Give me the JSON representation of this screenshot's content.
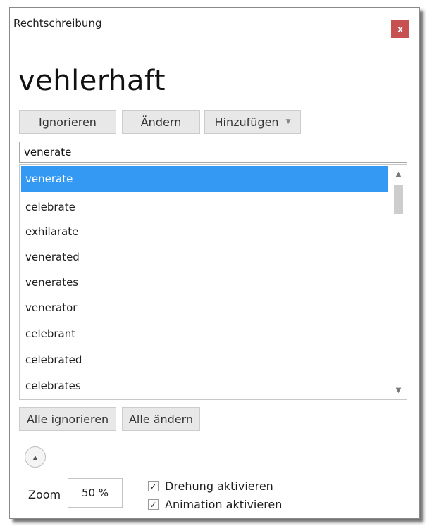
{
  "window": {
    "title": "Rechtschreibung",
    "close_label": "x"
  },
  "misspelled_word": "vehlerhaft",
  "actions": {
    "ignore": "Ignorieren",
    "change": "Ändern",
    "add": "Hinzufügen"
  },
  "icons": {
    "dropdown": "▼",
    "scroll_up": "▲",
    "scroll_down": "▼",
    "collapse": "▲",
    "check": "✓"
  },
  "replacement_input": {
    "value": "venerate"
  },
  "suggestions": {
    "selected_index": 0,
    "items": [
      "venerate",
      "celebrate",
      "exhilarate",
      "venerated",
      "venerates",
      "venerator",
      "celebrant",
      "celebrated",
      "celebrates"
    ]
  },
  "bulk_actions": {
    "ignore_all": "Alle ignorieren",
    "change_all": "Alle ändern"
  },
  "zoom": {
    "label": "Zoom",
    "value": "50 %"
  },
  "options": [
    {
      "label": "Drehung aktivieren",
      "checked": true
    },
    {
      "label": "Animation aktivieren",
      "checked": true
    }
  ],
  "colors": {
    "selection": "#3399f3",
    "close_button": "#c75050"
  }
}
